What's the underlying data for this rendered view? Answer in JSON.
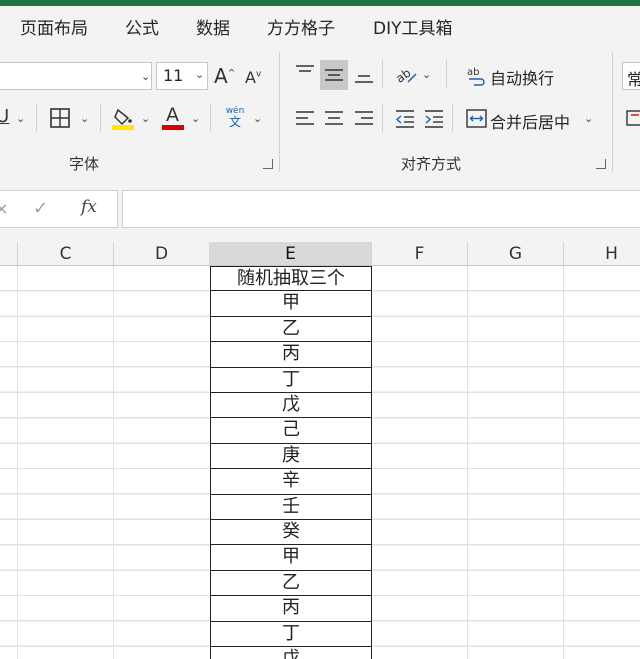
{
  "menu": [
    "页面布局",
    "公式",
    "数据",
    "方方格子",
    "DIY工具箱"
  ],
  "ribbon": {
    "font_size": "11",
    "grow_font": "A",
    "shrink_font": "A",
    "font_group_label": "字体",
    "align_group_label": "对齐方式",
    "wrap_text_label": "自动换行",
    "merge_center_label": "合并后居中",
    "partial_right_label": "常",
    "phonetic_top": "wén",
    "phonetic_bottom": "文",
    "font_color_letter": "A",
    "colors": {
      "highlight": "#ffe600",
      "font_color": "#e00000",
      "accent": "#217346"
    }
  },
  "formula_bar": {
    "fx_label": "fx",
    "value": ""
  },
  "columns": [
    "C",
    "D",
    "E",
    "F",
    "G",
    "H"
  ],
  "selected_column": "E",
  "table": {
    "header": "随机抽取三个",
    "items": [
      "甲",
      "乙",
      "丙",
      "丁",
      "戊",
      "己",
      "庚",
      "辛",
      "壬",
      "癸",
      "甲",
      "乙",
      "丙",
      "丁",
      "戊"
    ]
  }
}
